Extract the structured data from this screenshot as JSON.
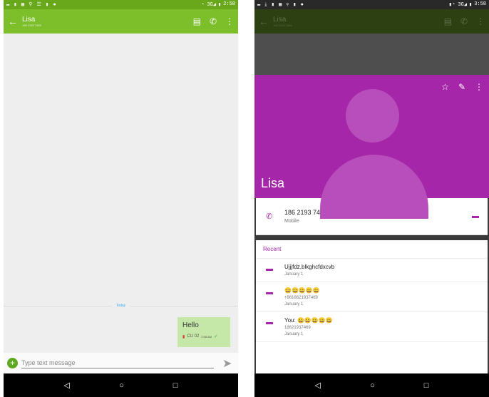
{
  "left": {
    "status": {
      "icons": "▬ ▮ ▦ ⚲ ☰ ▮ ●",
      "network": "◔ 3G◢",
      "battery": "▮",
      "time": "2:58"
    },
    "appbar": {
      "contact_name": "Lisa",
      "contact_number": "186 2193 7469"
    },
    "chat": {
      "date_label": "Today",
      "message": {
        "text": "Hello",
        "sim": "CU 02",
        "time": "2:58 AM"
      }
    },
    "composer": {
      "placeholder": "Type text message"
    }
  },
  "right": {
    "status": {
      "icons": "▬ ⤓ ▮ ▦ ⚲ ▮ ●",
      "network": "▮◔ 3G◢",
      "battery": "▮",
      "time": "3:58"
    },
    "appbar": {
      "contact_name": "Lisa",
      "contact_number": "186 2193 7469"
    },
    "header": {
      "name": "Lisa"
    },
    "phone": {
      "number": "186 2193 7469",
      "type": "Mobile"
    },
    "recent": {
      "heading": "Recent",
      "items": [
        {
          "title": "Ujjjfdz,blkghcfdxcvb",
          "sub": "",
          "date": "January 1"
        },
        {
          "title": "😀😀😀😀😀",
          "sub": "+8618621937469",
          "date": "January 1"
        },
        {
          "title": "You: 😀😀😀😀😀",
          "sub": "18621937469",
          "date": "January 1"
        }
      ]
    }
  },
  "icons": {
    "back": "←",
    "contact": "▤",
    "call": "✆",
    "more": "⋮",
    "star": "☆",
    "edit": "✎",
    "add": "+",
    "send": "➤",
    "nav_back": "◁",
    "nav_home": "○",
    "nav_recent": "□",
    "chat": "▬",
    "check": "✓",
    "sim": "▮"
  }
}
